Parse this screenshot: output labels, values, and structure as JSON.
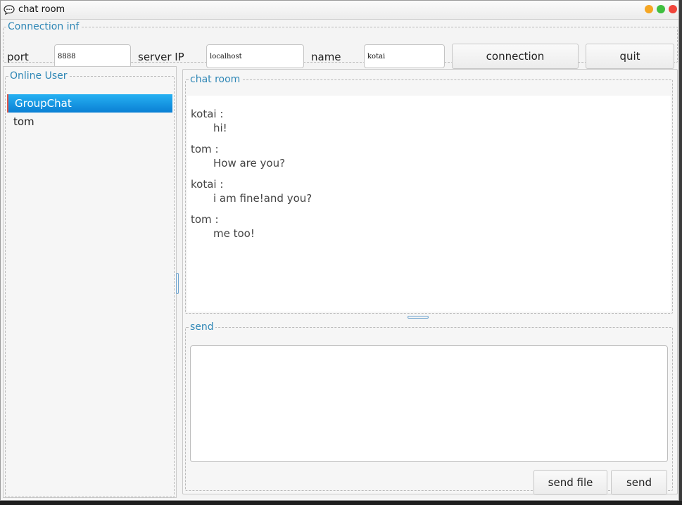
{
  "window": {
    "title": "chat room",
    "icon": "speech-bubble-icon",
    "controls": [
      "minimize-icon",
      "maximize-icon",
      "close-icon"
    ]
  },
  "connection": {
    "legend": "Connection inf",
    "port_label": "port",
    "port_value": "8888",
    "server_label": "server IP",
    "server_value": "localhost",
    "name_label": "name",
    "name_value": "kotai",
    "connect_button": "connection",
    "quit_button": "quit"
  },
  "users": {
    "legend": "Online User",
    "items": [
      {
        "label": "GroupChat",
        "selected": true
      },
      {
        "label": "tom",
        "selected": false
      }
    ]
  },
  "chat": {
    "legend": "chat room",
    "messages": [
      {
        "sender": "kotai :",
        "text": "hi!"
      },
      {
        "sender": "tom :",
        "text": "How are you?"
      },
      {
        "sender": "kotai :",
        "text": "i am fine!and you?"
      },
      {
        "sender": "tom :",
        "text": "me too!"
      }
    ]
  },
  "send": {
    "legend": "send",
    "input_value": "",
    "send_file_button": "send file",
    "send_button": "send"
  },
  "colors": {
    "accent": "#2f87b6",
    "selection": "#0a7fd4",
    "selection_marker": "#e1574c"
  }
}
